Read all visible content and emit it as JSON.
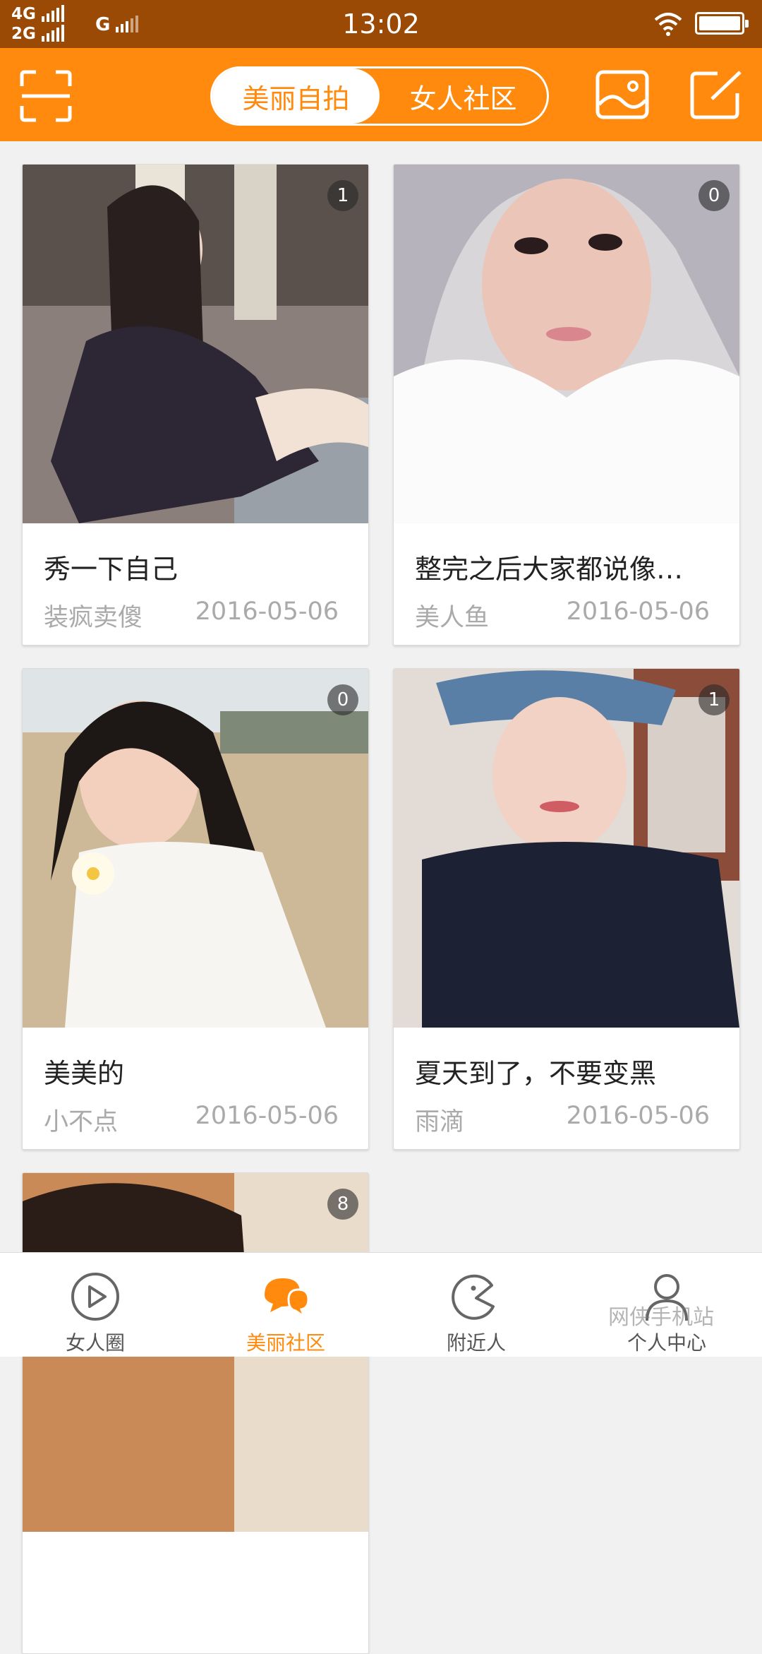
{
  "status_bar": {
    "network_1": "4G",
    "network_2": "2G",
    "network_3": "G",
    "time": "13:02"
  },
  "header": {
    "segments": [
      {
        "label": "美丽自拍",
        "active": true
      },
      {
        "label": "女人社区",
        "active": false
      }
    ],
    "icons": [
      "scan-icon",
      "gallery-icon",
      "compose-icon"
    ],
    "accent_color": "#ff8a0e"
  },
  "posts": [
    {
      "title": "秀一下自己",
      "author": "装疯卖傻",
      "date": "2016-05-06",
      "count": "1"
    },
    {
      "title": "整完之后大家都说像…",
      "author": "美人鱼",
      "date": "2016-05-06",
      "count": "0"
    },
    {
      "title": "美美的",
      "author": "小不点",
      "date": "2016-05-06",
      "count": "0"
    },
    {
      "title": "夏天到了，不要变黑",
      "author": "雨滴",
      "date": "2016-05-06",
      "count": "1"
    },
    {
      "title": "",
      "author": "",
      "date": "",
      "count": "8"
    }
  ],
  "tabbar": {
    "tabs": [
      {
        "label": "女人圈",
        "icon": "play-circle-icon",
        "active": false
      },
      {
        "label": "美丽社区",
        "icon": "chat-bubbles-icon",
        "active": true
      },
      {
        "label": "附近人",
        "icon": "pacman-icon",
        "active": false
      },
      {
        "label": "个人中心",
        "icon": "person-icon",
        "active": false
      }
    ]
  },
  "watermark": "网侠手机站"
}
